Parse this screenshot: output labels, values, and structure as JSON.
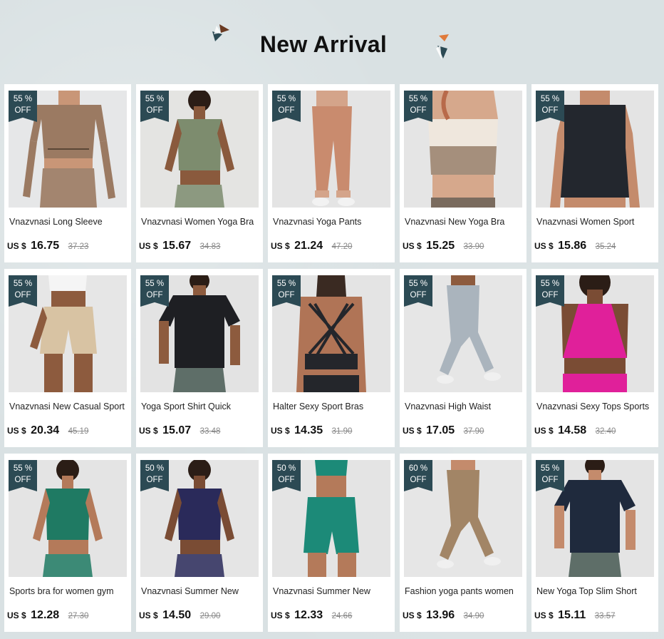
{
  "header": {
    "title": "New Arrival"
  },
  "products": [
    {
      "discount_num": "55 %",
      "discount_word": "OFF",
      "name": "Vnazvnasi Long Sleeve",
      "currency": "US $",
      "price": "16.75",
      "old_price": "37.23",
      "garment": "longsleeve",
      "color": "#9b7a62",
      "bg": "#e6e7e8",
      "skin": "#c99677"
    },
    {
      "discount_num": "55 %",
      "discount_word": "OFF",
      "name": "Vnazvnasi Women Yoga Bra",
      "currency": "US $",
      "price": "15.67",
      "old_price": "34.83",
      "garment": "croptop",
      "color": "#7d8c6e",
      "bg": "#e4e4e2",
      "skin": "#8a5a3d"
    },
    {
      "discount_num": "55 %",
      "discount_word": "OFF",
      "name": "Vnazvnasi Yoga Pants",
      "currency": "US $",
      "price": "21.24",
      "old_price": "47.20",
      "garment": "pants",
      "color": "#c98b6e",
      "bg": "#e4e4e4",
      "skin": "#d4a48a"
    },
    {
      "discount_num": "55 %",
      "discount_word": "OFF",
      "name": "Vnazvnasi New Yoga Bra",
      "currency": "US $",
      "price": "15.25",
      "old_price": "33.90",
      "garment": "bra",
      "color": "#a58f7c",
      "bg": "#e5e5e5",
      "skin": "#d6a88c"
    },
    {
      "discount_num": "55 %",
      "discount_word": "OFF",
      "name": "Vnazvnasi Women Sport",
      "currency": "US $",
      "price": "15.86",
      "old_price": "35.24",
      "garment": "tank",
      "color": "#23272e",
      "bg": "#e4e4e4",
      "skin": "#c48b6c"
    },
    {
      "discount_num": "55 %",
      "discount_word": "OFF",
      "name": "Vnazvnasi New Casual Sport",
      "currency": "US $",
      "price": "20.34",
      "old_price": "45.19",
      "garment": "shorts",
      "color": "#d8c3a3",
      "bg": "#e6e6e6",
      "skin": "#8d5b3e"
    },
    {
      "discount_num": "55 %",
      "discount_word": "OFF",
      "name": "Yoga Sport Shirt Quick",
      "currency": "US $",
      "price": "15.07",
      "old_price": "33.48",
      "garment": "tshirt",
      "color": "#1e1f23",
      "bg": "#e3e3e3",
      "skin": "#8d5b3e"
    },
    {
      "discount_num": "55 %",
      "discount_word": "OFF",
      "name": "Halter Sexy Sport Bras",
      "currency": "US $",
      "price": "14.35",
      "old_price": "31.90",
      "garment": "back",
      "color": "#24262b",
      "bg": "#e4e4e4",
      "skin": "#b07456"
    },
    {
      "discount_num": "55 %",
      "discount_word": "OFF",
      "name": "Vnazvnasi High Waist",
      "currency": "US $",
      "price": "17.05",
      "old_price": "37.90",
      "garment": "leggings",
      "color": "#aab4bd",
      "bg": "#e6e6e6",
      "skin": "#8d5b3e"
    },
    {
      "discount_num": "55 %",
      "discount_word": "OFF",
      "name": "Vnazvnasi Sexy Tops Sports",
      "currency": "US $",
      "price": "14.58",
      "old_price": "32.40",
      "garment": "racerback",
      "color": "#e0209a",
      "bg": "#e4e4e4",
      "skin": "#7a4c34"
    },
    {
      "discount_num": "55 %",
      "discount_word": "OFF",
      "name": "Sports bra for women gym",
      "currency": "US $",
      "price": "12.28",
      "old_price": "27.30",
      "garment": "croptop",
      "color": "#1f7a63",
      "bg": "#e4e4e4",
      "skin": "#b47a5a"
    },
    {
      "discount_num": "50 %",
      "discount_word": "OFF",
      "name": "Vnazvnasi Summer New",
      "currency": "US $",
      "price": "14.50",
      "old_price": "29.00",
      "garment": "croptop",
      "color": "#2a2a5a",
      "bg": "#e5e5e5",
      "skin": "#7a4c34"
    },
    {
      "discount_num": "50 %",
      "discount_word": "OFF",
      "name": "Vnazvnasi Summer New",
      "currency": "US $",
      "price": "12.33",
      "old_price": "24.66",
      "garment": "bikeshorts",
      "color": "#1c8a78",
      "bg": "#e4e4e4",
      "skin": "#b47a5a"
    },
    {
      "discount_num": "60 %",
      "discount_word": "OFF",
      "name": "Fashion yoga pants women",
      "currency": "US $",
      "price": "13.96",
      "old_price": "34.90",
      "garment": "leggings",
      "color": "#a28566",
      "bg": "#e6e6e6",
      "skin": "#c48b6c"
    },
    {
      "discount_num": "55 %",
      "discount_word": "OFF",
      "name": "New Yoga Top Slim Short",
      "currency": "US $",
      "price": "15.11",
      "old_price": "33.57",
      "garment": "tshirt",
      "color": "#1f2a3d",
      "bg": "#e4e4e4",
      "skin": "#c48b6c"
    }
  ]
}
